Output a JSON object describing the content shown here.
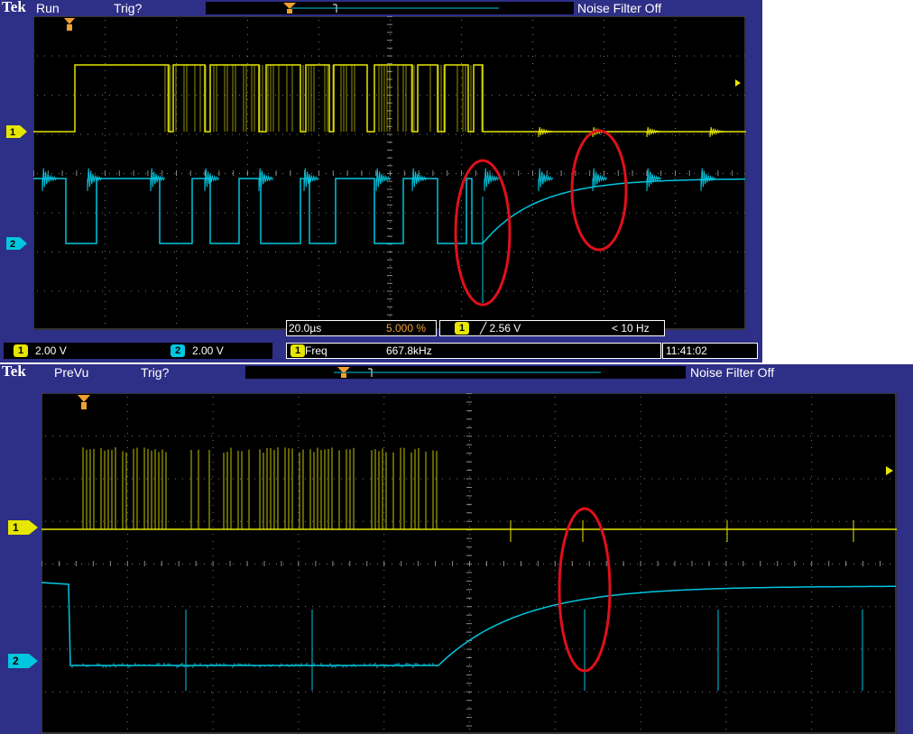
{
  "scope1": {
    "brand": "Tek",
    "state": "Run",
    "trig_status": "Trig?",
    "noise_filter": "Noise Filter Off",
    "ch1_marker": "1",
    "ch2_marker": "2",
    "time_per_div": "20.0µs",
    "trigger_position": "5.000 %",
    "trigger_channel": "1",
    "trigger_level": "╱ 2.56 V",
    "trigger_freq": "< 10 Hz",
    "ch1_scale": "2.00 V",
    "ch2_scale": "2.00 V",
    "meas_channel": "1",
    "meas_label": "Freq",
    "meas_value": "667.8kHz",
    "clock": "11:41:02"
  },
  "scope2": {
    "brand": "Tek",
    "state": "PreVu",
    "trig_status": "Trig?",
    "noise_filter": "Noise Filter Off",
    "ch1_marker": "1",
    "ch2_marker": "2"
  },
  "colors": {
    "frame": "#2e2f86",
    "ch1": "#e6e600",
    "ch2": "#00c6e0",
    "trigger": "#f0a030",
    "annotation": "#e0101a"
  }
}
